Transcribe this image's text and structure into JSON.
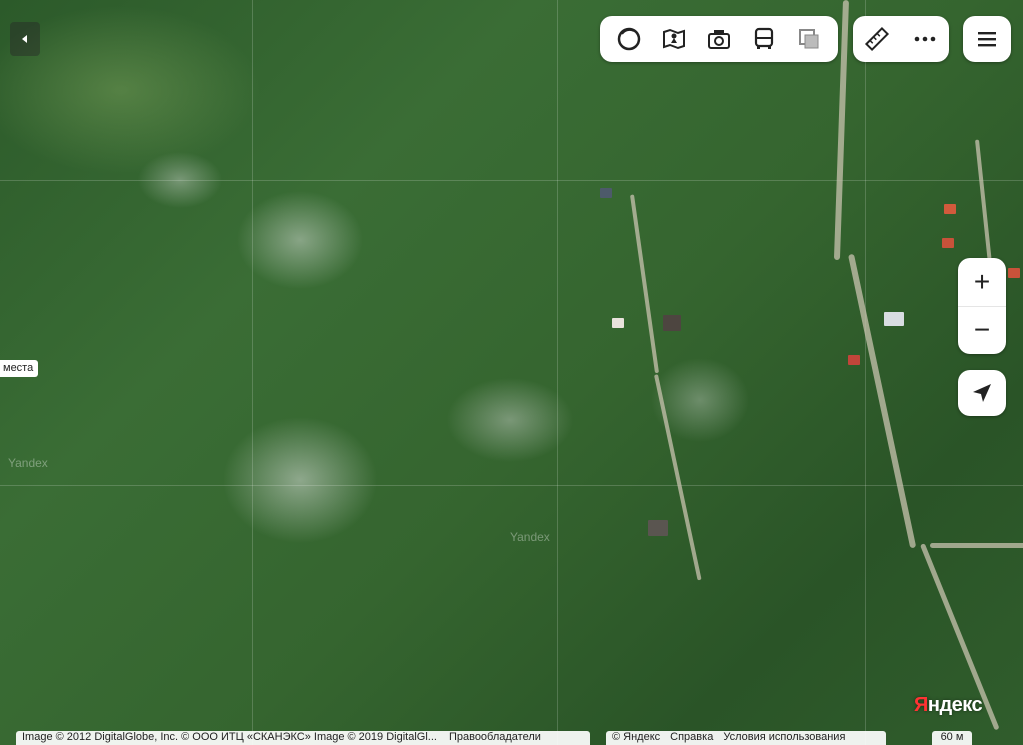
{
  "map": {
    "places_label": "места",
    "watermark_1": "Yandex",
    "watermark_2": "Yandex"
  },
  "toolbar": {
    "tools": [
      "layers-icon",
      "panorama-icon",
      "photo-icon",
      "transit-icon",
      "copy-icon"
    ],
    "ruler": "ruler-icon",
    "more": "more-icon",
    "menu": "menu-icon"
  },
  "zoom": {
    "in_label": "+",
    "out_label": "−"
  },
  "footer": {
    "attribution": "Image © 2012 DigitalGlobe, Inc. © ООО ИТЦ «СКАНЭКС» Image © 2019 DigitalGl...",
    "owners": "Правообладатели",
    "copyright": "© Яндекс",
    "help": "Справка",
    "terms": "Условия использования",
    "scale": "60 м"
  },
  "logo": {
    "first": "Я",
    "rest": "ндекс"
  },
  "colors": {
    "accent": "#ff3333",
    "panel": "#ffffff"
  }
}
